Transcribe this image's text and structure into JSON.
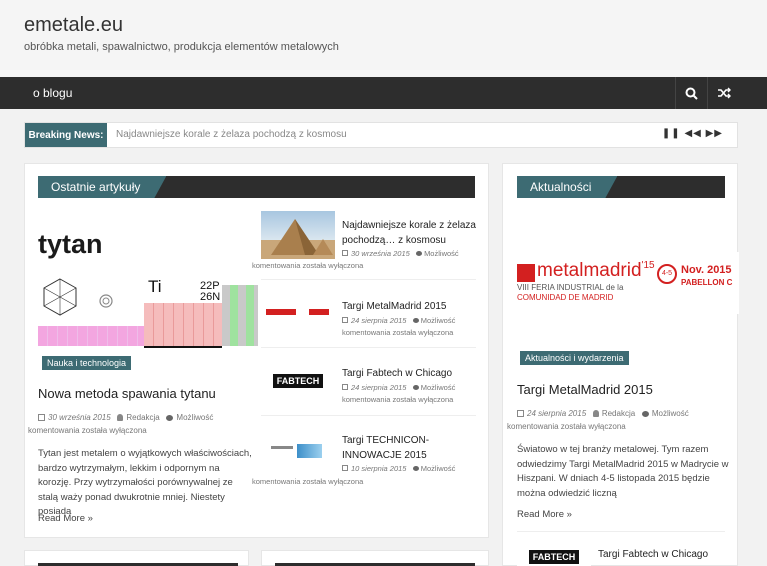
{
  "header": {
    "site_title": "emetale.eu",
    "site_description": "obróbka metali, spawalnictwo, produkcja elementów metalowych"
  },
  "nav": {
    "items": [
      {
        "label": "o blogu"
      }
    ],
    "search_icon": "search-icon",
    "random_icon": "shuffle-icon"
  },
  "breaking": {
    "label": "Breaking News:",
    "text": "Najdawniejsze korale z żelaza pochodzą   z kosmosu",
    "controls_icons": [
      "pause-icon",
      "prev-icon",
      "next-icon"
    ]
  },
  "latest": {
    "heading": "Ostatnie artykuły",
    "featured": {
      "image_text": "tytan",
      "element_symbol": "Ti",
      "element_number": "22",
      "element_suffix_1": "P",
      "element_number_2": "26",
      "element_suffix_2": "N",
      "category": "Nauka i technologia",
      "title": "Nowa metoda spawania tytanu",
      "date": "30 września 2015",
      "author": "Redakcja",
      "comments": "Możliwość",
      "comments_2": "komentowania została wyłączona",
      "excerpt": "Tytan jest metalem o wyjątkowych właściwościach, bardzo wytrzymałym, lekkim i odpornym na korozję. Przy wytrzymałości porównywalnej ze stalą waży ponad dwukrotnie mniej. Niestety posiada",
      "read_more": "Read More »"
    },
    "list": [
      {
        "title": "Najdawniejsze korale z żelaza pochodzą… z kosmosu",
        "date": "30 września 2015",
        "comments": "Możliwość",
        "comments_2": "komentowania została wyłączona"
      },
      {
        "title": "Targi MetalMadrid 2015",
        "date": "24 sierpnia 2015",
        "comments": "Możliwość",
        "comments_2": "komentowania została wyłączona"
      },
      {
        "title": "Targi Fabtech w Chicago",
        "date": "24 sierpnia 2015",
        "comments": "Możliwość",
        "comments_2": "komentowania została wyłączona"
      },
      {
        "title": "Targi TECHNICON-INNOWACJE 2015",
        "date": "10 sierpnia 2015",
        "comments": "Możliwość",
        "comments_2": "komentowania została wyłączona"
      }
    ]
  },
  "news": {
    "heading": "Aktualności",
    "featured": {
      "logo_text": "metalmadrid",
      "logo_sub_1": "VIII FERIA INDUSTRIAL de la",
      "logo_sub_2": "COMUNIDAD DE MADRID",
      "logo_year": "'15",
      "logo_date": "Nov. 2015",
      "logo_days": "4-5",
      "logo_venue": "PABELLON C",
      "category": "Aktualności i wydarzenia",
      "title": "Targi MetalMadrid 2015",
      "date": "24 sierpnia 2015",
      "author": "Redakcja",
      "comments": "Możliwość",
      "comments_2": "komentowania została wyłączona",
      "excerpt": "Światowo w tej branży metalowej. Tym razem odwiedzimy Targi MetalMadrid 2015 w Madrycie w Hiszpani. W dniach 4-5 listopada 2015 będzie można odwiedzić liczną",
      "read_more": "Read More »"
    },
    "list": [
      {
        "title": "Targi Fabtech w Chicago"
      }
    ]
  },
  "colors": {
    "accent": "#3d6b73",
    "nav_bg": "#2d2d2d"
  }
}
